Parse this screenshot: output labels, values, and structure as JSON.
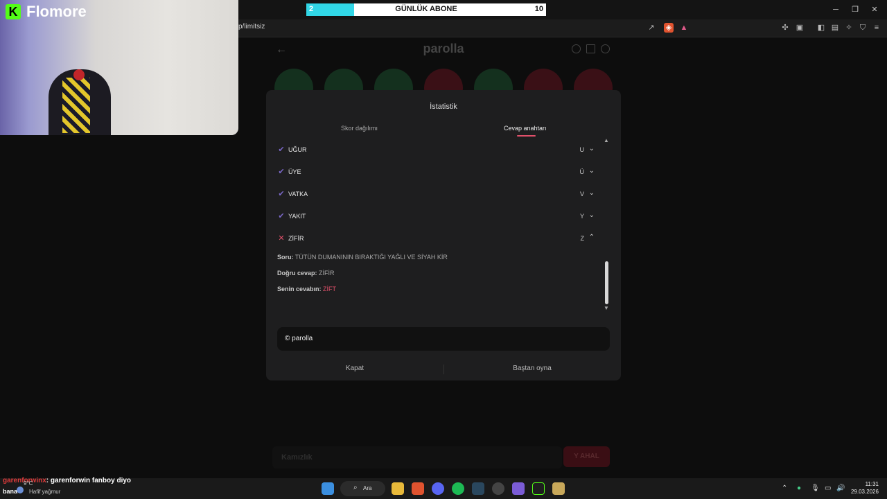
{
  "browser": {
    "url": "p/limitsiz",
    "window_controls": [
      "minimize",
      "restore",
      "close"
    ]
  },
  "overlay": {
    "label": "GÜNLÜK ABONE",
    "current": "2",
    "goal": "10",
    "progress_fraction": 0.2
  },
  "webcam": {
    "brand": "Flomore",
    "brand_letter": "K"
  },
  "game": {
    "title": "parolla",
    "answer_placeholder": "Kamızlık",
    "answer_button": "Y AHAL"
  },
  "modal": {
    "title": "İstatistik",
    "tabs": [
      {
        "label": "Skor dağılımı",
        "active": false
      },
      {
        "label": "Cevap anahtarı",
        "active": true
      }
    ],
    "rows": [
      {
        "word": "UĞUR",
        "letter": "U",
        "correct": true,
        "expanded": false
      },
      {
        "word": "ÜYE",
        "letter": "Ü",
        "correct": true,
        "expanded": false
      },
      {
        "word": "VATKA",
        "letter": "V",
        "correct": true,
        "expanded": false
      },
      {
        "word": "YAKIT",
        "letter": "Y",
        "correct": true,
        "expanded": false
      },
      {
        "word": "ZİFİR",
        "letter": "Z",
        "correct": false,
        "expanded": true
      }
    ],
    "detail": {
      "question_label": "Soru:",
      "question": "TÜTÜN DUMANININ BIRAKTIĞI YAĞLI VE SİYAH KİR",
      "correct_label": "Doğru cevap:",
      "correct_answer": "ZİFİR",
      "yours_label": "Senin cevabın:",
      "your_answer": "ZİFT"
    },
    "copyright": "© parolla",
    "close_button": "Kapat",
    "restart_button": "Baştan oyna"
  },
  "chat": {
    "user": "garenforwinx",
    "message": ": garenforwin fanboy diyo"
  },
  "taskbar": {
    "search": "Ara",
    "weather_temp": "9°C",
    "weather_desc": "Hafif yağmur",
    "left_text": "bana",
    "time": "11:31",
    "date": "29.03.2026"
  },
  "colors": {
    "correct": "#7b68c8",
    "wrong": "#e0506a",
    "tab_accent": "#e0506a",
    "overlay_fill": "#31d6e6"
  }
}
